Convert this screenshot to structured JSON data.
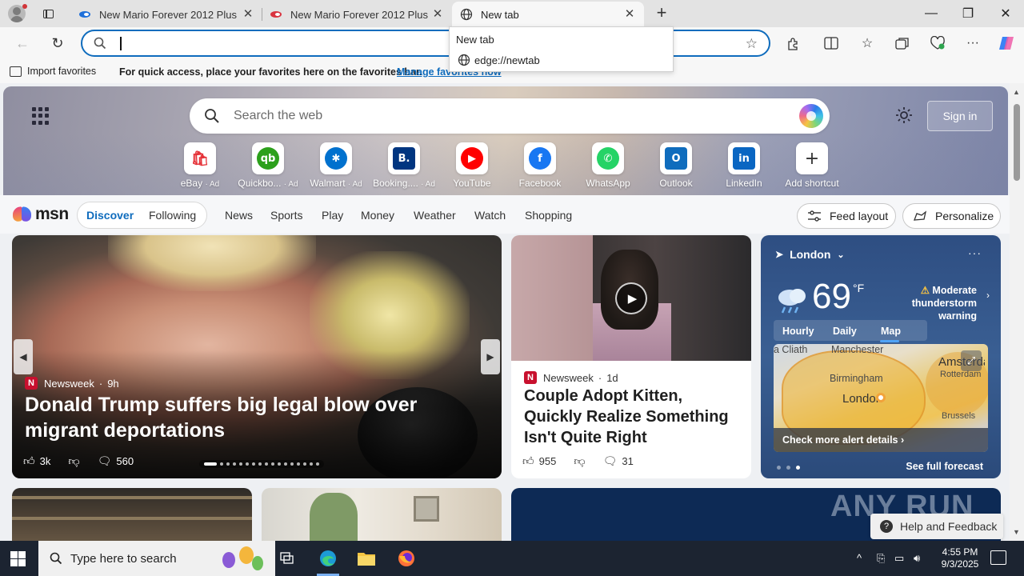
{
  "browser": {
    "tabs": [
      {
        "title": "New Mario Forever 2012 Plus",
        "state": "inactive",
        "favicon": "mario-blue-icon"
      },
      {
        "title": "New Mario Forever 2012 Plus",
        "state": "inactive",
        "favicon": "mario-red-icon"
      },
      {
        "title": "New tab",
        "state": "active",
        "favicon": "globe-icon"
      }
    ],
    "new_tab_glyph": "+",
    "close_glyph": "✕",
    "window_controls": {
      "minimize": "—",
      "restore": "❐",
      "close": "✕"
    }
  },
  "toolbar": {
    "address_value": "",
    "star_glyph": "☆",
    "icons": [
      "back-icon",
      "refresh-icon",
      "extensions-icon",
      "split-screen-icon",
      "favorites-icon",
      "collections-icon",
      "browser-essentials-icon",
      "more-icon",
      "copilot-icon"
    ]
  },
  "autocomplete": {
    "title": "New tab",
    "url": "edge://newtab"
  },
  "favorites_bar": {
    "import_label": "Import favorites",
    "message": "For quick access, place your favorites here on the favorites bar.",
    "manage_link": "Manage favorites now"
  },
  "newtab": {
    "search_placeholder": "Search the web",
    "sign_in": "Sign in",
    "shortcuts": [
      {
        "label": "eBay",
        "ad": "· Ad",
        "color": "#ffffff",
        "icon": "ebay-bag-icon"
      },
      {
        "label": "Quickbo...",
        "ad": "· Ad",
        "color": "#2ca01c",
        "icon": "quickbooks-icon"
      },
      {
        "label": "Walmart",
        "ad": "· Ad",
        "color": "#0071ce",
        "icon": "walmart-icon"
      },
      {
        "label": "Booking....",
        "ad": "· Ad",
        "color": "#003580",
        "icon": "booking-icon"
      },
      {
        "label": "YouTube",
        "ad": "",
        "color": "#ff0000",
        "icon": "youtube-icon"
      },
      {
        "label": "Facebook",
        "ad": "",
        "color": "#1877f2",
        "icon": "facebook-icon"
      },
      {
        "label": "WhatsApp",
        "ad": "",
        "color": "#25d366",
        "icon": "whatsapp-icon"
      },
      {
        "label": "Outlook",
        "ad": "",
        "color": "#0f6cbd",
        "icon": "outlook-icon"
      },
      {
        "label": "LinkedIn",
        "ad": "",
        "color": "#0a66c2",
        "icon": "linkedin-icon"
      },
      {
        "label": "Add shortcut",
        "ad": "",
        "color": "#ffffff",
        "icon": "plus-icon"
      }
    ]
  },
  "msn": {
    "logo_text": "msn",
    "tabs": [
      "Discover",
      "Following",
      "News",
      "Sports",
      "Play",
      "Money",
      "Weather",
      "Watch",
      "Shopping"
    ],
    "selected_tab": "Discover",
    "feed_layout": "Feed layout",
    "personalize": "Personalize"
  },
  "feed": {
    "lead": {
      "source": "Newsweek",
      "age": "9h",
      "title": "Donald Trump suffers big legal blow over migrant deportations",
      "likes": "3k",
      "comments": "560"
    },
    "second": {
      "source": "Newsweek",
      "age": "1d",
      "title": "Couple Adopt Kitten, Quickly Realize Something Isn't Quite Right",
      "likes": "955",
      "comments": "31"
    }
  },
  "weather": {
    "location": "London",
    "temperature": "69",
    "unit": "°F",
    "alert": "Moderate thunderstorm warning",
    "tabs": [
      "Hourly",
      "Daily",
      "Map"
    ],
    "selected_tab": "Map",
    "map_places": [
      "Manchester",
      "Birmingham",
      "London",
      "Amsterdam",
      "Rotterdam",
      "Brussels",
      "a Cliath"
    ],
    "alert_details": "Check more alert details",
    "forecast_link": "See full forecast"
  },
  "overlay": {
    "watermark": "ANY RUN",
    "help": "Help and Feedback"
  },
  "taskbar": {
    "search_placeholder": "Type here to search",
    "time": "4:55 PM",
    "date": "9/3/2025"
  }
}
